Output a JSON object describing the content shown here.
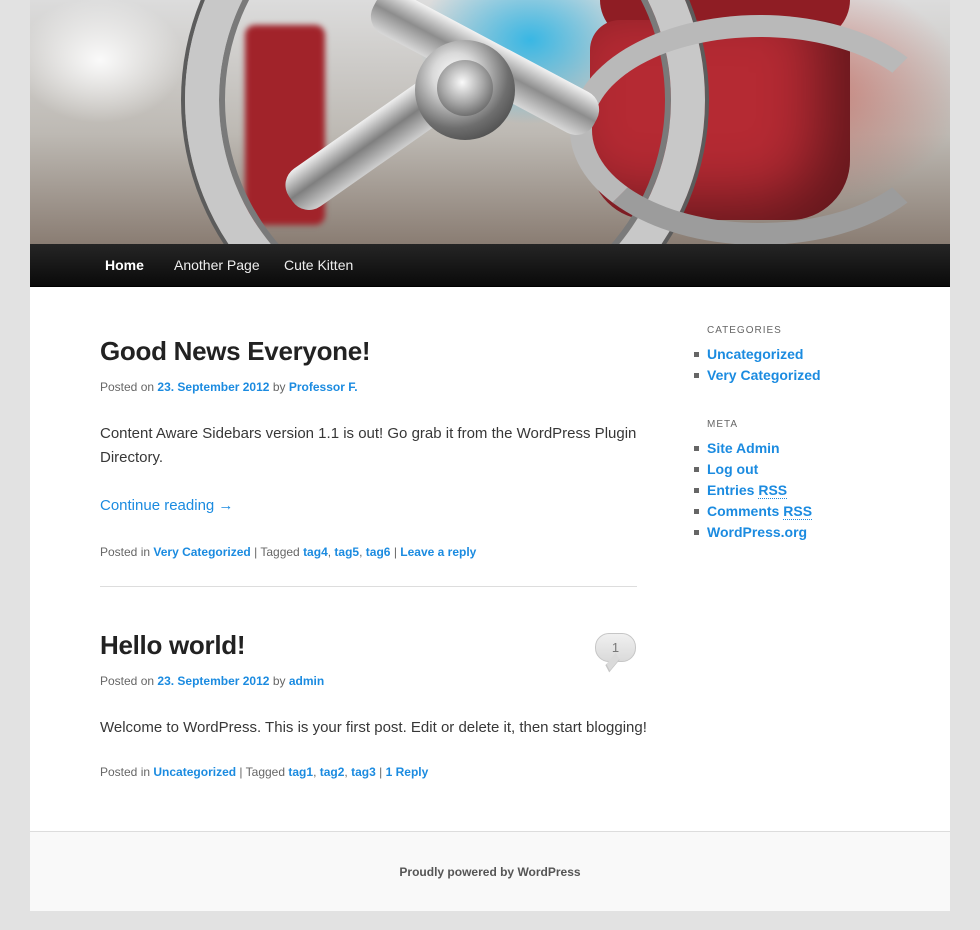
{
  "nav": {
    "items": [
      {
        "label": "Home",
        "active": true
      },
      {
        "label": "Another Page",
        "active": false
      },
      {
        "label": "Cute Kitten",
        "active": false
      }
    ]
  },
  "posts": [
    {
      "title": "Good News Everyone!",
      "posted_on_prefix": "Posted on",
      "date": "23. September 2012",
      "by": "by",
      "author": "Professor F.",
      "excerpt": "Content Aware Sidebars version 1.1 is out! Go grab it from the WordPress Plugin Directory.",
      "continue": "Continue reading →",
      "posted_in_prefix": "Posted in",
      "category": "Very Categorized",
      "tagged_prefix": "| Tagged",
      "tags": [
        "tag4",
        "tag5",
        "tag6"
      ],
      "reply_sep": "|",
      "reply": "Leave a reply"
    },
    {
      "title": "Hello world!",
      "posted_on_prefix": "Posted on",
      "date": "23. September 2012",
      "by": "by",
      "author": "admin",
      "excerpt": "Welcome to WordPress. This is your first post. Edit or delete it, then start blogging!",
      "comment_count": "1",
      "posted_in_prefix": "Posted in",
      "category": "Uncategorized",
      "tagged_prefix": "| Tagged",
      "tags": [
        "tag1",
        "tag2",
        "tag3"
      ],
      "reply_sep": "|",
      "reply": "1 Reply"
    }
  ],
  "sidebar": {
    "categories_title": "CATEGORIES",
    "categories": [
      "Uncategorized",
      "Very Categorized"
    ],
    "meta_title": "META",
    "meta": {
      "site_admin": "Site Admin",
      "log_out": "Log out",
      "entries": "Entries",
      "comments": "Comments",
      "rss": "RSS",
      "wordpress": "WordPress.org"
    }
  },
  "footer": {
    "credit": "Proudly powered by WordPress"
  }
}
